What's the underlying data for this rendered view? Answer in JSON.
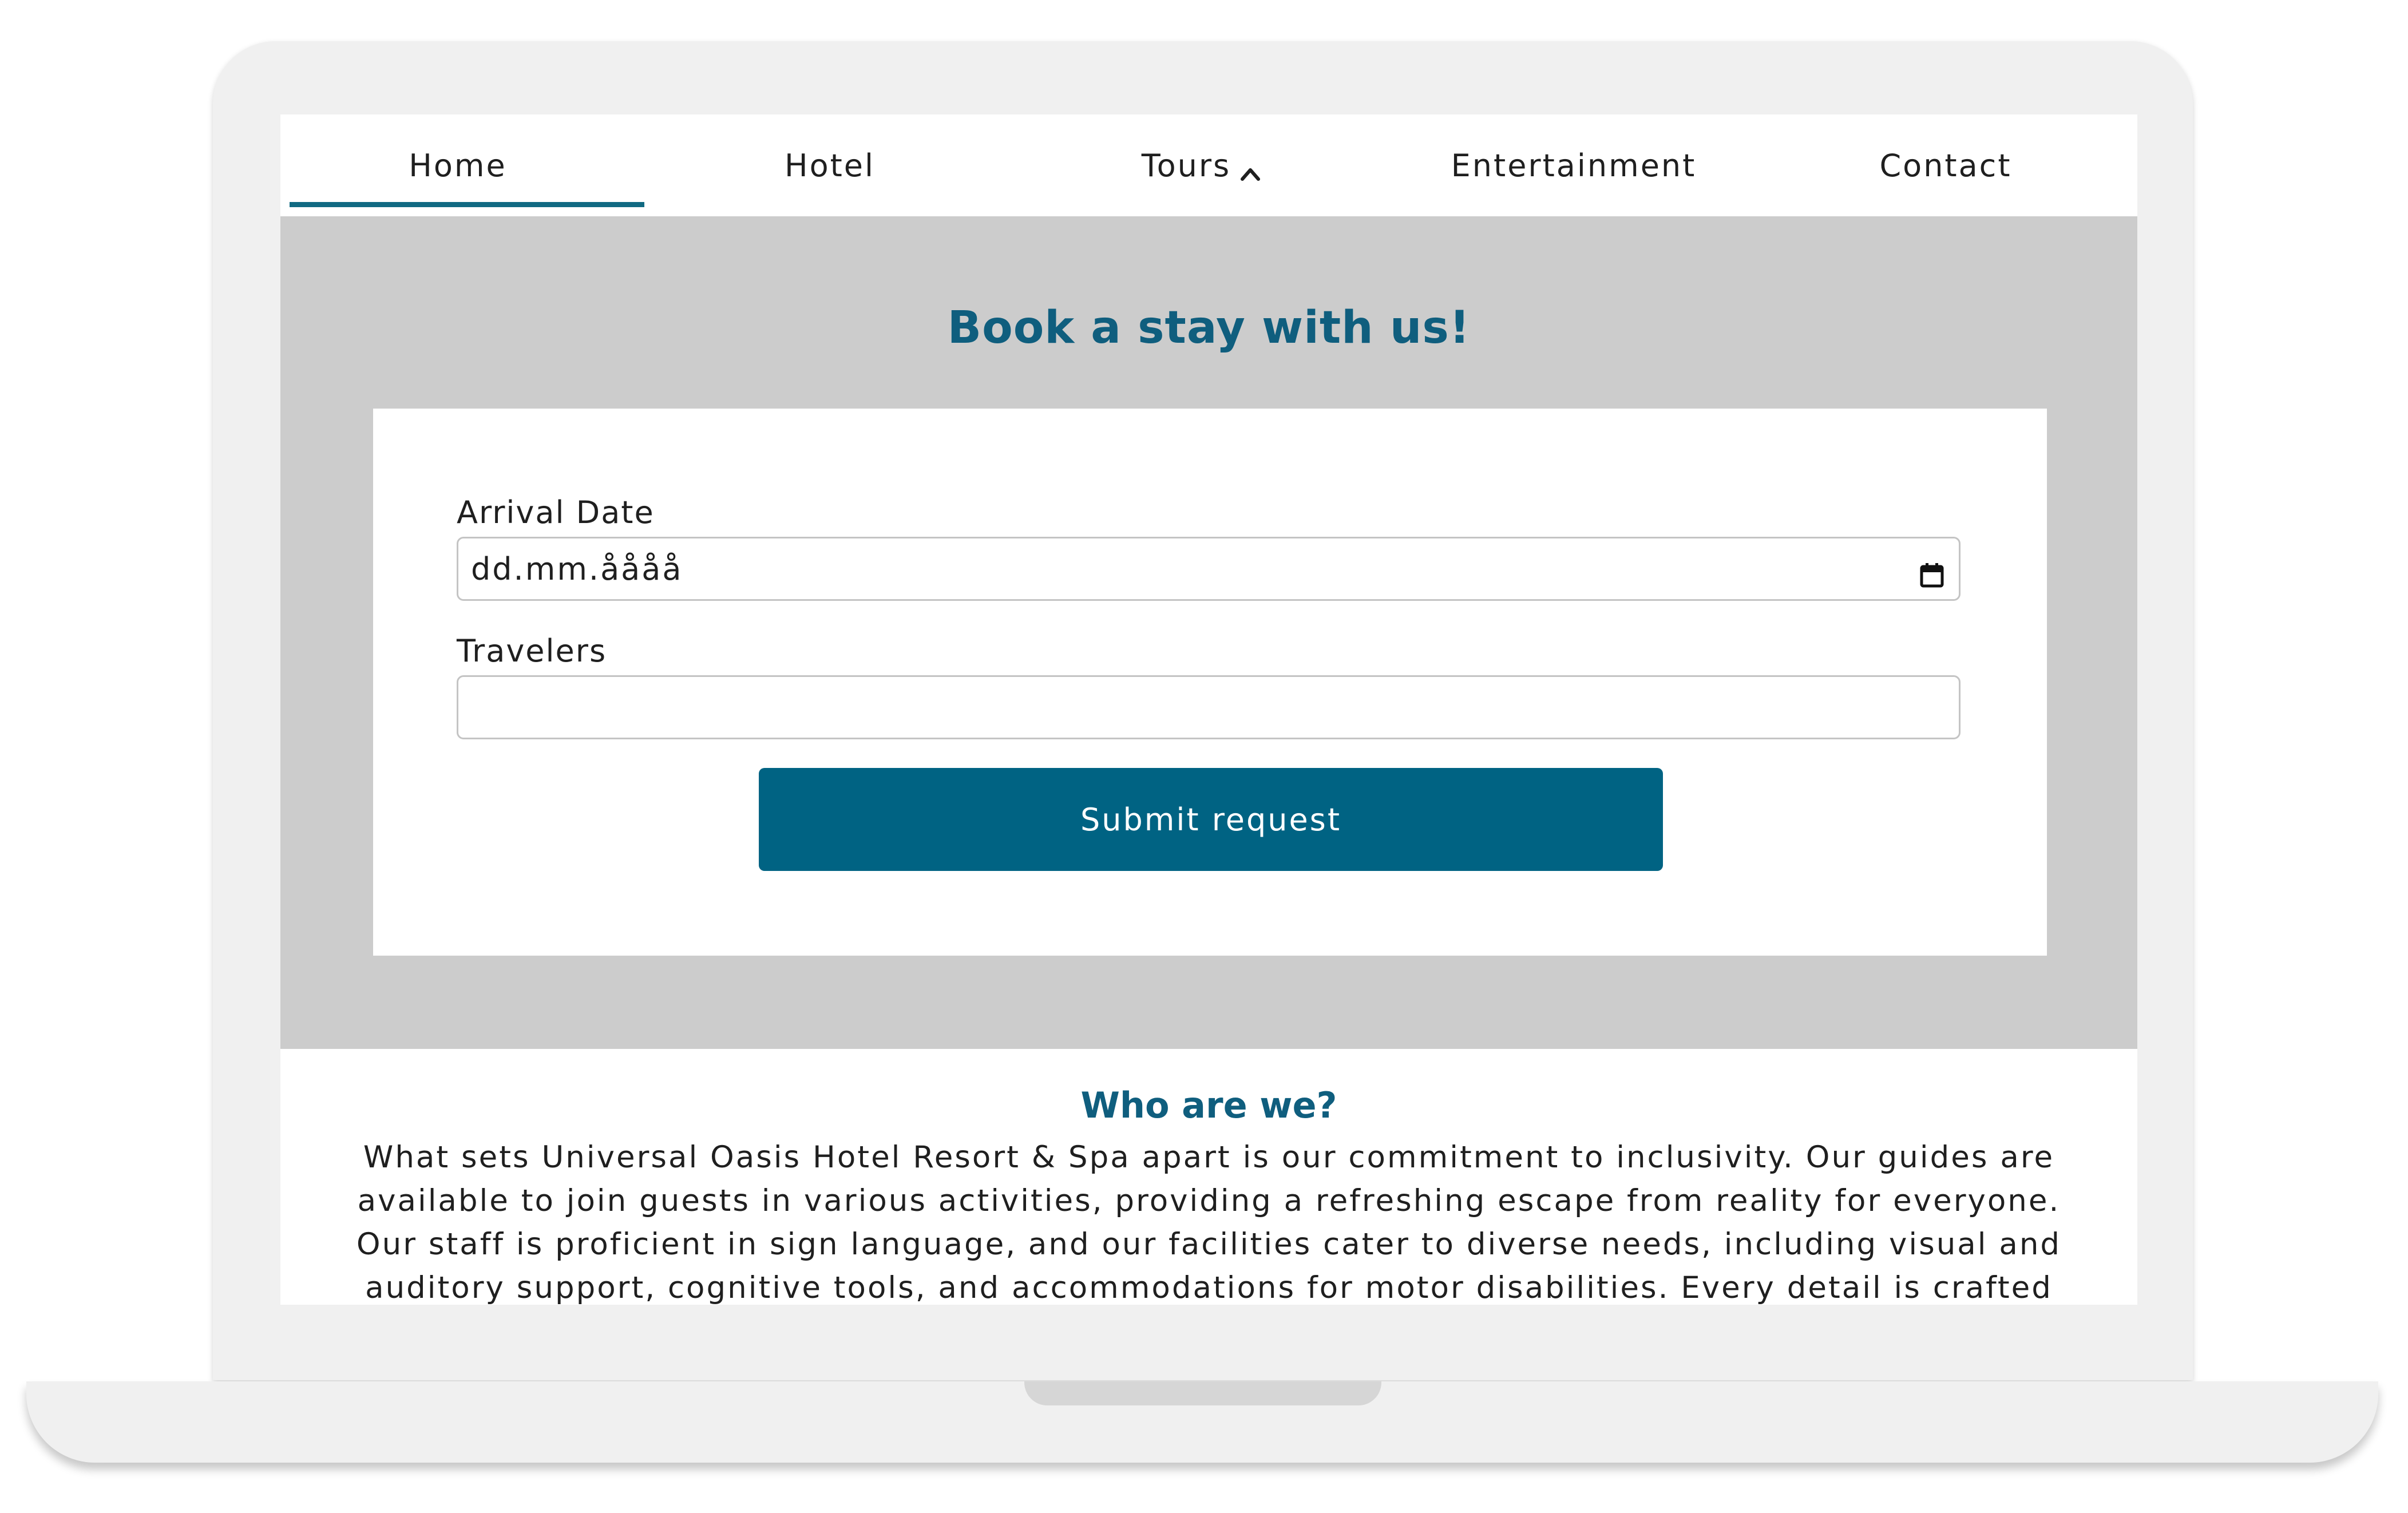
{
  "nav": {
    "items": [
      {
        "label": "Home",
        "active": true
      },
      {
        "label": "Hotel",
        "active": false
      },
      {
        "label": "Tours",
        "active": false,
        "icon": "chevron-up-icon"
      },
      {
        "label": "Entertainment",
        "active": false
      },
      {
        "label": "Contact",
        "active": false
      }
    ]
  },
  "booking": {
    "title": "Book a stay with us!",
    "arrival_label": "Arrival Date",
    "arrival_placeholder": "dd.mm.åååå",
    "arrival_icon": "calendar-icon",
    "travelers_label": "Travelers",
    "travelers_value": "",
    "submit_label": "Submit request"
  },
  "about": {
    "title": "Who are we?",
    "text": "What sets Universal Oasis Hotel Resort & Spa apart is our commitment to inclusivity. Our guides are available to join guests in various activities, providing a refreshing escape from reality for everyone. Our staff is proficient in sign language, and our facilities cater to diverse needs, including visual and auditory support, cognitive tools, and accommodations for motor disabilities. Every detail is crafted with care to ensure all guests can fully enjoy"
  },
  "colors": {
    "accent": "#006383",
    "heading": "#0f5e7e",
    "section_bg": "#cccccc",
    "bezel": "#f0f0f0"
  }
}
